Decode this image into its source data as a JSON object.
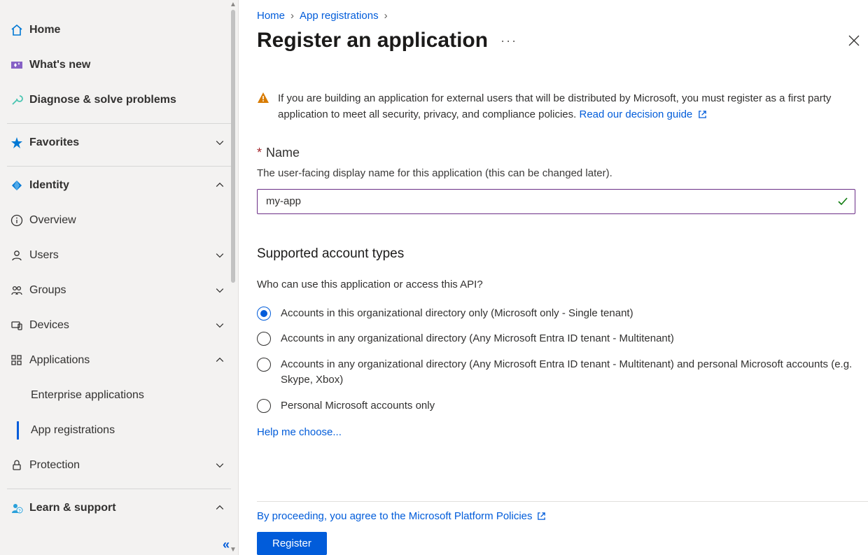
{
  "sidebar": {
    "items": [
      {
        "label": "Home",
        "icon": "home",
        "bold": true
      },
      {
        "label": "What's new",
        "icon": "sparkle",
        "bold": true
      },
      {
        "label": "Diagnose & solve problems",
        "icon": "wrench",
        "bold": true
      },
      {
        "divider": true
      },
      {
        "label": "Favorites",
        "icon": "star",
        "bold": true,
        "chev": "down"
      },
      {
        "divider": true
      },
      {
        "label": "Identity",
        "icon": "diamond",
        "bold": true,
        "chev": "up"
      },
      {
        "label": "Overview",
        "icon": "info"
      },
      {
        "label": "Users",
        "icon": "user",
        "chev": "down"
      },
      {
        "label": "Groups",
        "icon": "group",
        "chev": "down"
      },
      {
        "label": "Devices",
        "icon": "device",
        "chev": "down"
      },
      {
        "label": "Applications",
        "icon": "apps",
        "chev": "up"
      },
      {
        "label": "Enterprise applications",
        "sub": true
      },
      {
        "label": "App registrations",
        "sub": true,
        "active": true
      },
      {
        "label": "Protection",
        "icon": "lock",
        "chev": "down"
      },
      {
        "divider": true
      },
      {
        "label": "Learn & support",
        "icon": "person-q",
        "bold": true,
        "chev": "up"
      }
    ]
  },
  "breadcrumb": [
    {
      "label": "Home"
    },
    {
      "label": "App registrations"
    }
  ],
  "page_title": "Register an application",
  "alert": {
    "text": "If you are building an application for external users that will be distributed by Microsoft, you must register as a first party application to meet all security, privacy, and compliance policies. ",
    "link_text": "Read our decision guide"
  },
  "name_field": {
    "label": "Name",
    "required_marker": "*",
    "description": "The user-facing display name for this application (this can be changed later).",
    "value": "my-app"
  },
  "account_types": {
    "heading": "Supported account types",
    "question": "Who can use this application or access this API?",
    "options": [
      "Accounts in this organizational directory only (Microsoft only - Single tenant)",
      "Accounts in any organizational directory (Any Microsoft Entra ID tenant - Multitenant)",
      "Accounts in any organizational directory (Any Microsoft Entra ID tenant - Multitenant) and personal Microsoft accounts (e.g. Skype, Xbox)",
      "Personal Microsoft accounts only"
    ],
    "selected_index": 0,
    "help_link": "Help me choose..."
  },
  "footer": {
    "consent_text": "By proceeding, you agree to the Microsoft Platform Policies",
    "button": "Register"
  }
}
